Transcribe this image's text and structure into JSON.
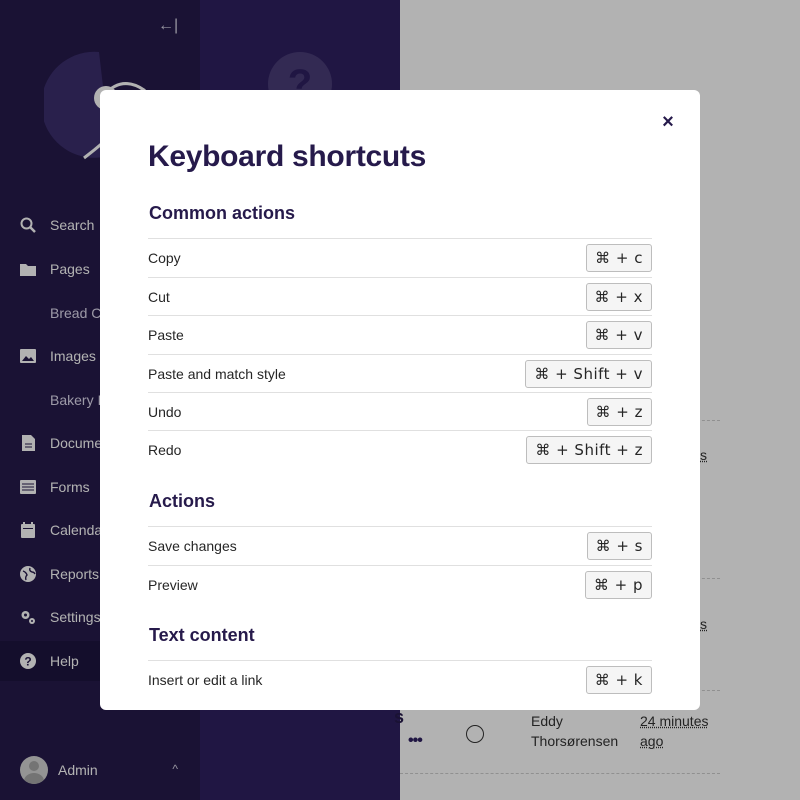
{
  "sidebar": {
    "collapse_icon": "←|",
    "items": [
      {
        "label": "Search",
        "icon": "search-icon",
        "glyph": "⚲"
      },
      {
        "label": "Pages",
        "icon": "folder-icon",
        "glyph": "▬"
      },
      {
        "label": "Bread C",
        "icon": "",
        "glyph": ""
      },
      {
        "label": "Images",
        "icon": "image-icon",
        "glyph": "▣"
      },
      {
        "label": "Bakery I",
        "icon": "",
        "glyph": ""
      },
      {
        "label": "Docume",
        "icon": "document-icon",
        "glyph": "▤"
      },
      {
        "label": "Forms",
        "icon": "list-icon",
        "glyph": "☰"
      },
      {
        "label": "Calenda",
        "icon": "calendar-icon",
        "glyph": "▦"
      },
      {
        "label": "Reports",
        "icon": "globe-icon",
        "glyph": "◍"
      },
      {
        "label": "Settings",
        "icon": "cogs-icon",
        "glyph": "⚙"
      },
      {
        "label": "Help",
        "icon": "help-icon",
        "glyph": "?"
      }
    ],
    "user": {
      "name": "Admin",
      "chevron": "^"
    }
  },
  "background": {
    "help_glyph": "?",
    "row_text": "s",
    "more": "•••",
    "author_first": "Eddy",
    "author_last": "Thorsørensen",
    "time_1": "24 minutes",
    "time_2": "ago",
    "partial_1": "s",
    "partial_2": "s"
  },
  "modal": {
    "title": "Keyboard shortcuts",
    "close_glyph": "×",
    "sections": [
      {
        "title": "Common actions",
        "rows": [
          {
            "label": "Copy",
            "keys": "⌘ + c"
          },
          {
            "label": "Cut",
            "keys": "⌘ + x"
          },
          {
            "label": "Paste",
            "keys": "⌘ + v"
          },
          {
            "label": "Paste and match style",
            "keys": "⌘ + Shift + v"
          },
          {
            "label": "Undo",
            "keys": "⌘ + z"
          },
          {
            "label": "Redo",
            "keys": "⌘ + Shift + z"
          }
        ]
      },
      {
        "title": "Actions",
        "rows": [
          {
            "label": "Save changes",
            "keys": "⌘ + s"
          },
          {
            "label": "Preview",
            "keys": "⌘ + p"
          }
        ]
      },
      {
        "title": "Text content",
        "rows": [
          {
            "label": "Insert or edit a link",
            "keys": "⌘ + k"
          }
        ]
      }
    ]
  },
  "colors": {
    "sidebar": "#261a4b",
    "panel": "#2e2060",
    "accent": "#261a4b"
  }
}
